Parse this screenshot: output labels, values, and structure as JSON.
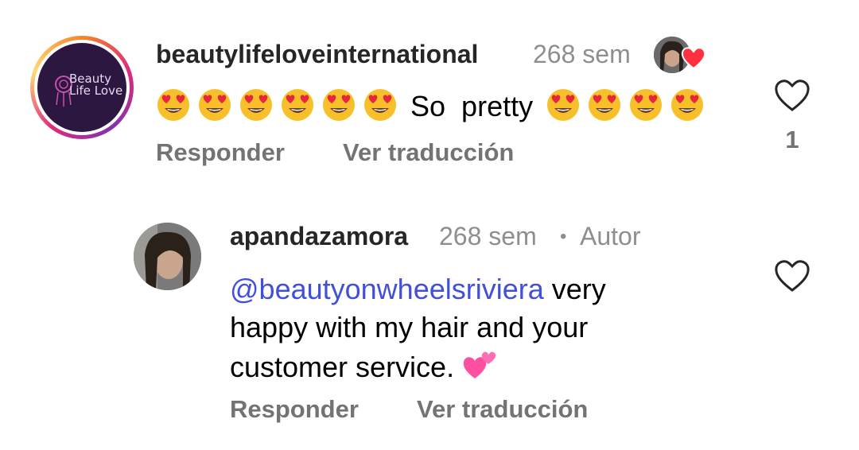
{
  "comment": {
    "username": "beautylifeloveinternational",
    "time": "268 sem",
    "brand_logo_text": "Beauty Life Love",
    "emojis_before": [
      "heart-eyes",
      "heart-eyes",
      "heart-eyes",
      "heart-eyes",
      "heart-eyes",
      "heart-eyes"
    ],
    "text": "So  pretty",
    "emojis_after": [
      "heart-eyes",
      "heart-eyes",
      "heart-eyes",
      "heart-eyes"
    ],
    "reply_label": "Responder",
    "translate_label": "Ver traducción",
    "like_count": "1",
    "liked_by_author": true
  },
  "reply": {
    "username": "apandazamora",
    "time": "268 sem",
    "separator": "•",
    "author_badge": "Autor",
    "mention": "@beautyonwheelsriviera",
    "text_line1": " very",
    "text_line2": "happy with my hair and your",
    "text_line3": "customer service. ",
    "trailing_emoji": "two-hearts",
    "reply_label": "Responder",
    "translate_label": "Ver traducción"
  },
  "colors": {
    "mention": "#4150d8",
    "heart_red": "#ff3040",
    "meta_gray": "#8e8e8e"
  }
}
